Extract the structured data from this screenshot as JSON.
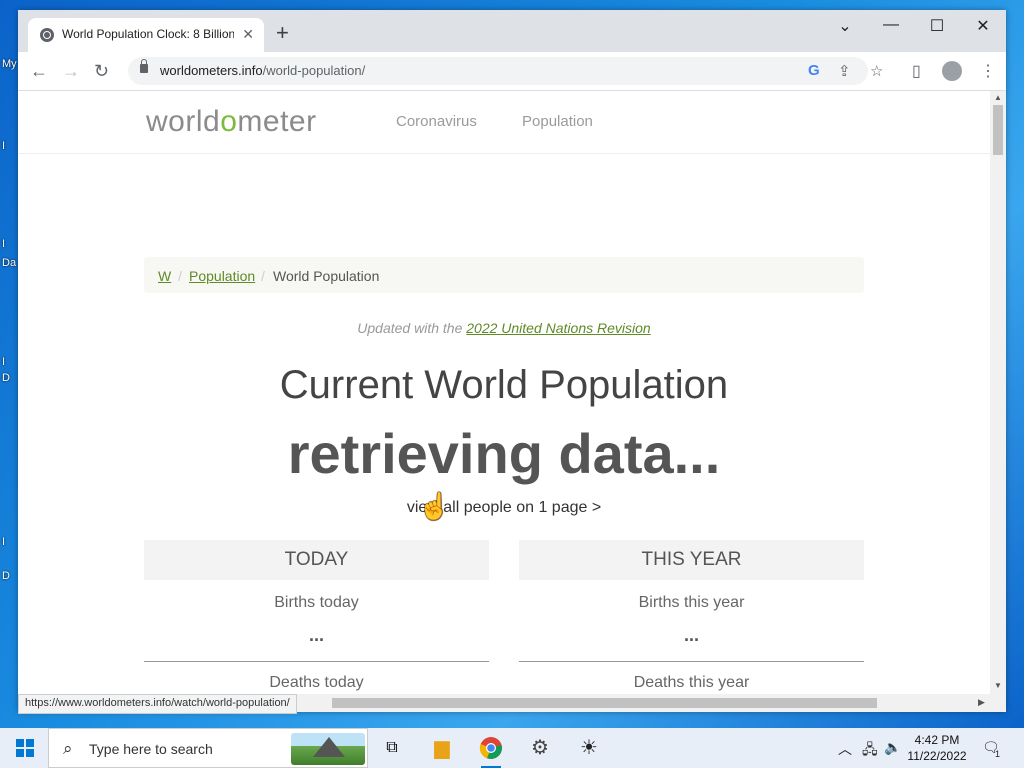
{
  "desktop": {
    "labels": [
      "My",
      "I",
      "I",
      "Da",
      "I",
      "D",
      "I",
      "D"
    ]
  },
  "browser": {
    "tab_title": "World Population Clock: 8 Billion",
    "tab_close": "✕",
    "new_tab": "+",
    "window_controls": {
      "dropdown": "⌄",
      "minimize": "—",
      "maximize": "☐",
      "close": "✕"
    },
    "url_host": "worldometers.info",
    "url_path": "/world-population/",
    "status_url": "https://www.worldometers.info/watch/world-population/"
  },
  "site": {
    "logo_prefix": "world",
    "logo_o": "o",
    "logo_suffix": "meter",
    "nav": [
      "Coronavirus",
      "Population"
    ],
    "breadcrumb": {
      "home": "W",
      "section": "Population",
      "current": "World Population",
      "sep": "/"
    },
    "updated_prefix": "Updated with the",
    "updated_link": "2022 United Nations Revision",
    "headline": "Current World Population",
    "counter": "retrieving data...",
    "view_all": "view all people on 1 page >",
    "today": {
      "header": "TODAY",
      "births_label": "Births today",
      "births_value": "...",
      "deaths_label": "Deaths today"
    },
    "this_year": {
      "header": "THIS YEAR",
      "births_label": "Births this year",
      "births_value": "...",
      "deaths_label": "Deaths this year"
    }
  },
  "taskbar": {
    "search_placeholder": "Type here to search",
    "time": "4:42 PM",
    "date": "11/22/2022",
    "notification_count": "1"
  },
  "colors": {
    "accent_green": "#7cbb3a",
    "link_green": "#5f8a26",
    "windows_blue": "#0078d4"
  }
}
